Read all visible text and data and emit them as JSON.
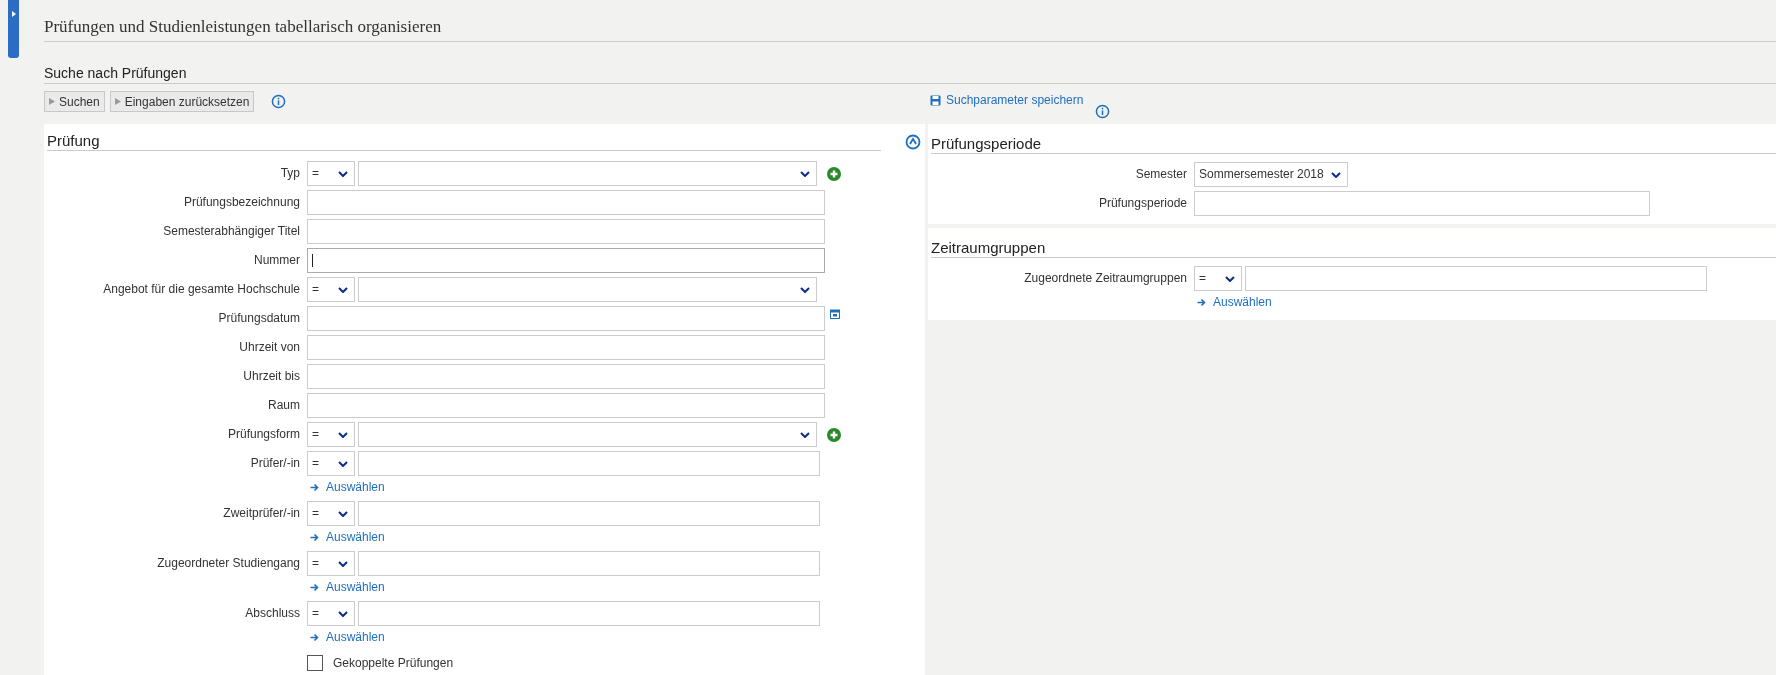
{
  "page_title": "Prüfungen und Studienleistungen tabellarisch organisieren",
  "section_title": "Suche nach Prüfungen",
  "toolbar": {
    "buttons": [
      "Suchen",
      "Eingaben zurücksetzen"
    ],
    "save_link": "Suchparameter speichern"
  },
  "main_panel": {
    "title": "Prüfung",
    "fields": [
      {
        "kind": "select",
        "label": "Typ",
        "operator": "=",
        "add": true
      },
      {
        "kind": "text",
        "label": "Prüfungsbezeichnung",
        "focused": false
      },
      {
        "kind": "text",
        "label": "Semesterabhängiger Titel",
        "focused": false
      },
      {
        "kind": "text",
        "label": "Nummer",
        "focused": true
      },
      {
        "kind": "select",
        "label": "Angebot für die gesamte Hochschule",
        "operator": "=",
        "add": false
      },
      {
        "kind": "date",
        "label": "Prüfungsdatum",
        "focused": false
      },
      {
        "kind": "text",
        "label": "Uhrzeit von",
        "focused": false
      },
      {
        "kind": "text",
        "label": "Uhrzeit bis",
        "focused": false
      },
      {
        "kind": "text",
        "label": "Raum",
        "focused": false
      },
      {
        "kind": "select",
        "label": "Prüfungsform",
        "operator": "=",
        "add": true
      },
      {
        "kind": "picker",
        "label": "Prüfer/-in",
        "operator": "=",
        "link": "Auswählen"
      },
      {
        "kind": "picker",
        "label": "Zweitprüfer/-in",
        "operator": "=",
        "link": "Auswählen"
      },
      {
        "kind": "picker",
        "label": "Zugeordneter Studiengang",
        "operator": "=",
        "link": "Auswählen"
      },
      {
        "kind": "picker",
        "label": "Abschluss",
        "operator": "=",
        "link": "Auswählen"
      },
      {
        "kind": "checkbox",
        "label": "Gekoppelte Prüfungen",
        "checked": false
      }
    ]
  },
  "side_panels": [
    {
      "title": "Prüfungsperiode",
      "fields": [
        {
          "kind": "dropdown",
          "label": "Semester",
          "value": "Sommersemester 2018"
        },
        {
          "kind": "text",
          "label": "Prüfungsperiode",
          "focused": false
        }
      ]
    },
    {
      "title": "Zeitraumgruppen",
      "fields": [
        {
          "kind": "picker",
          "label": "Zugeordnete Zeitraumgruppen",
          "operator": "=",
          "link": "Auswählen"
        }
      ]
    }
  ]
}
